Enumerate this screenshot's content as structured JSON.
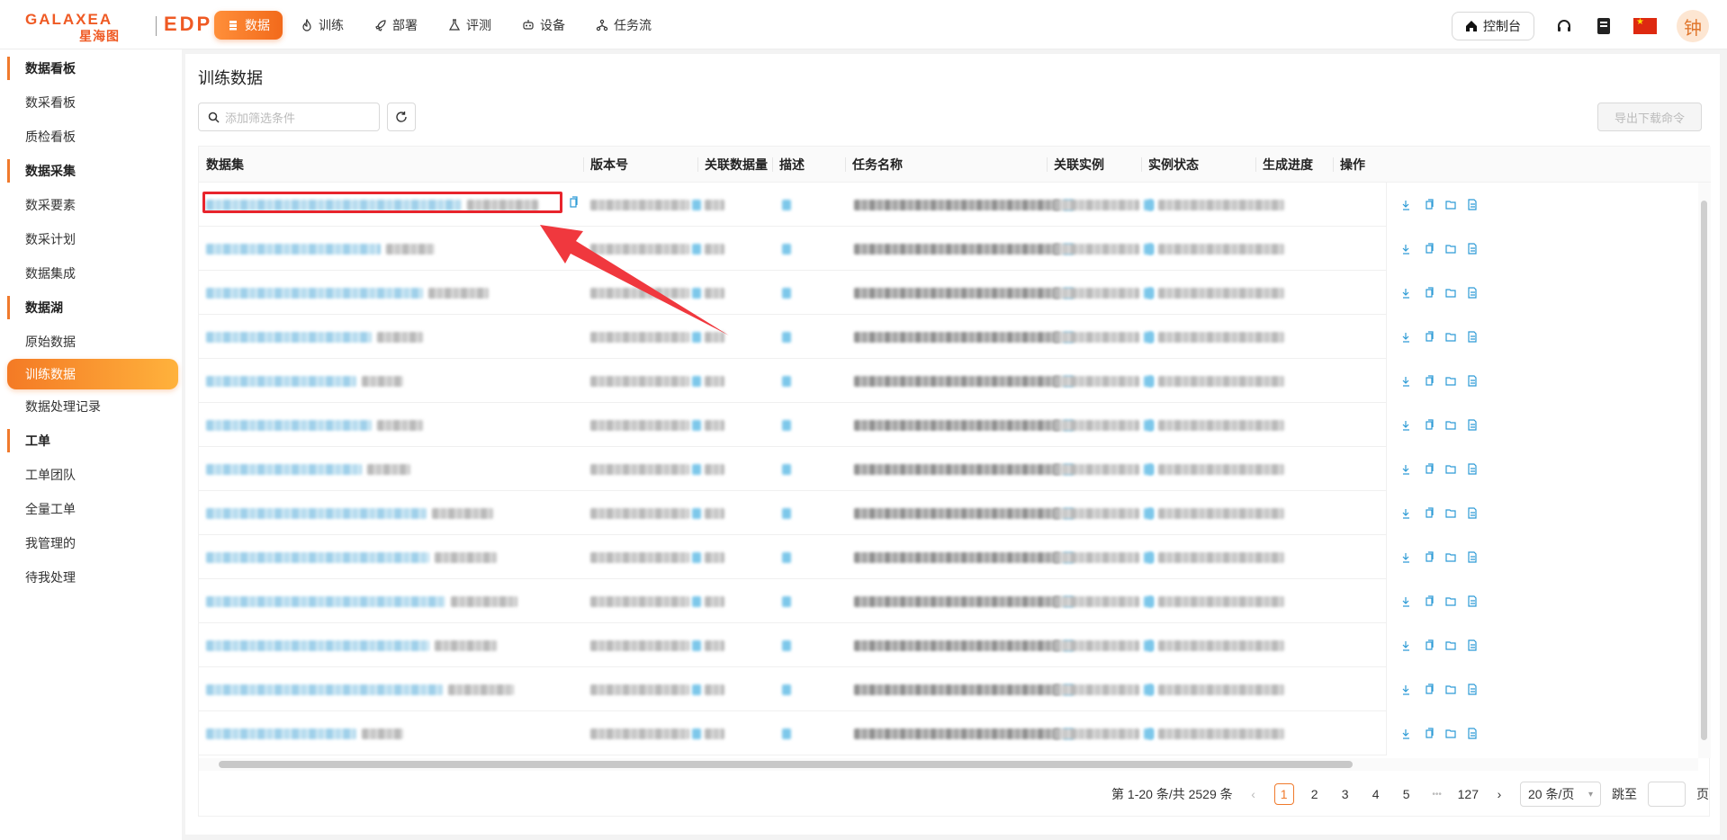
{
  "brand": {
    "name": "GALAXEA",
    "name_cn": "星海图",
    "product": "EDP",
    "accent": "#f26a1b"
  },
  "nav": [
    {
      "label": "数据",
      "icon": "database-icon",
      "active": true
    },
    {
      "label": "训练",
      "icon": "flame-icon"
    },
    {
      "label": "部署",
      "icon": "rocket-icon"
    },
    {
      "label": "评测",
      "icon": "flask-icon"
    },
    {
      "label": "设备",
      "icon": "robot-icon"
    },
    {
      "label": "任务流",
      "icon": "workflow-icon"
    }
  ],
  "header": {
    "console_label": "控制台",
    "avatar_text": "钟"
  },
  "sidebar": [
    {
      "group": "数据看板",
      "items": [
        "数采看板",
        "质检看板"
      ]
    },
    {
      "group": "数据采集",
      "items": [
        "数采要素",
        "数采计划",
        "数据集成"
      ]
    },
    {
      "group": "数据湖",
      "items": [
        "原始数据",
        "训练数据",
        "数据处理记录"
      ]
    },
    {
      "group": "工单",
      "items": [
        "工单团队",
        "全量工单",
        "我管理的",
        "待我处理"
      ]
    }
  ],
  "sidebar_active": "训练数据",
  "page": {
    "title": "训练数据",
    "filter_placeholder": "添加筛选条件",
    "export_label": "导出下载命令"
  },
  "table": {
    "columns": [
      "数据集",
      "版本号",
      "关联数据量",
      "描述",
      "任务名称",
      "关联实例",
      "实例状态",
      "生成进度",
      "操作"
    ],
    "row_count": 13
  },
  "pagination": {
    "summary": "第 1-20 条/共 2529 条",
    "pages": [
      "1",
      "2",
      "3",
      "4",
      "5"
    ],
    "ellipsis": "•••",
    "last": "127",
    "current": "1",
    "page_size": "20 条/页",
    "jump_label": "跳至",
    "page_suffix": "页"
  }
}
